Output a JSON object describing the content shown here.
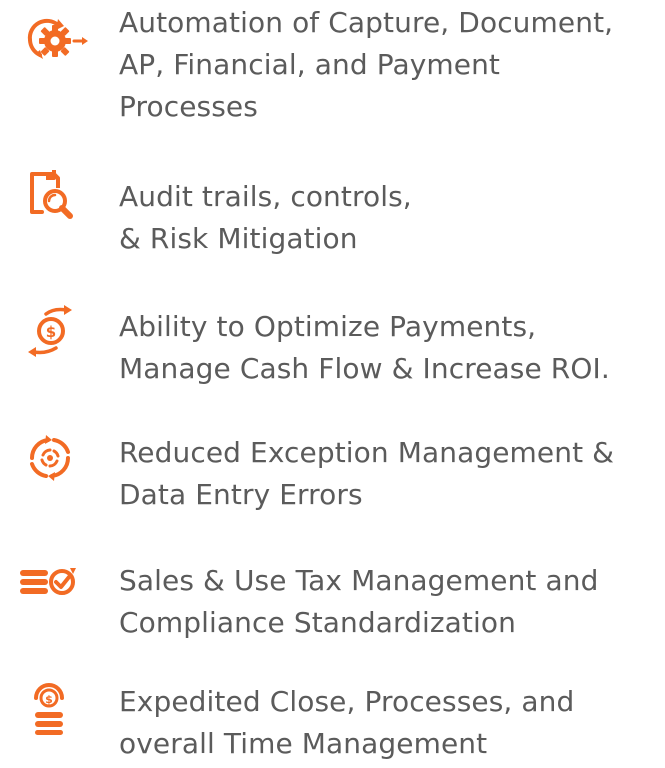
{
  "theme": {
    "accent": "#f26b24",
    "text": "#5b5b5b"
  },
  "features": [
    {
      "icon": "gear-arrows-icon",
      "lines": [
        "Automation of Capture, Document,",
        "AP, Financial, and Payment",
        "Processes"
      ]
    },
    {
      "icon": "document-magnifier-icon",
      "lines": [
        "Audit trails, controls,",
        "& Risk Mitigation"
      ]
    },
    {
      "icon": "dollar-exchange-arrows-icon",
      "lines": [
        "Ability to Optimize Payments,",
        "Manage Cash Flow & Increase ROI."
      ]
    },
    {
      "icon": "circular-cycle-icon",
      "lines": [
        "Reduced Exception Management &",
        "Data Entry Errors"
      ]
    },
    {
      "icon": "coins-checkmark-icon",
      "lines": [
        "Sales & Use Tax Management and",
        "Compliance Standardization"
      ]
    },
    {
      "icon": "dollar-coin-stack-icon",
      "lines": [
        "Expedited Close, Processes, and",
        "overall Time Management"
      ]
    }
  ]
}
